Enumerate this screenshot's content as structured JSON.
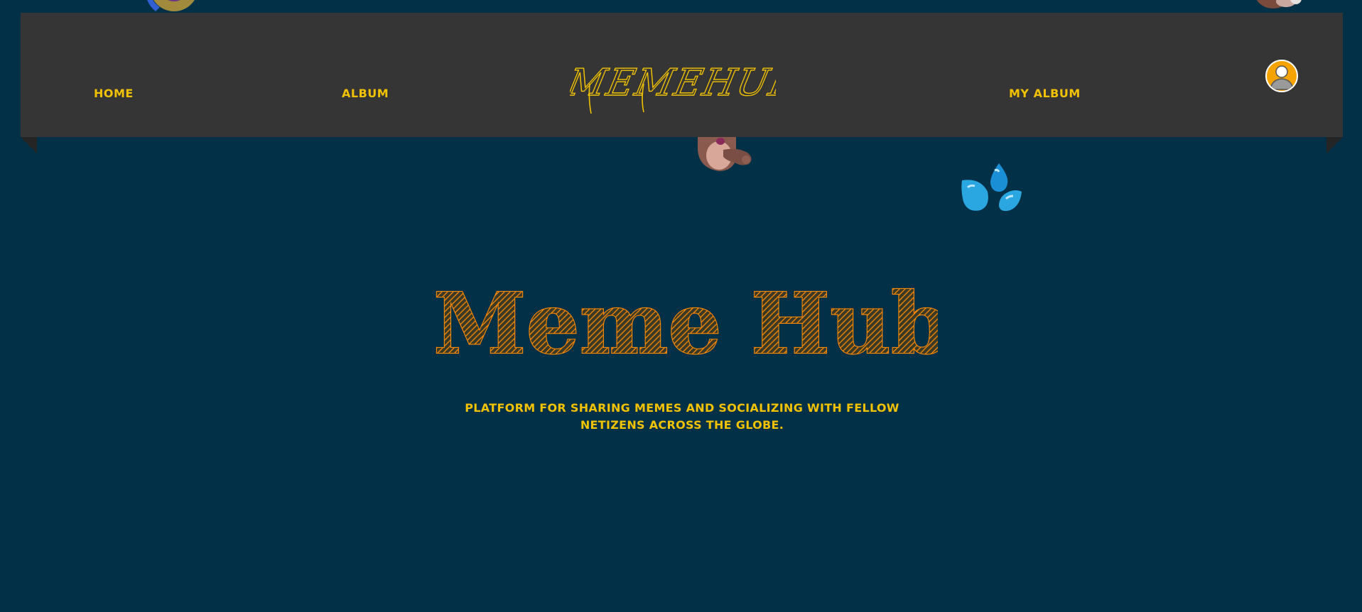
{
  "colors": {
    "background": "#023047",
    "navbar": "#353535",
    "accent_yellow": "#f2c200",
    "title_orange": "#ff8a00",
    "avatar_bg": "#f5a300"
  },
  "nav": {
    "home_label": "HOME",
    "album_label": "ALBUM",
    "logo_text": "MEMEHUB",
    "my_album_label": "MY ALBUM",
    "avatar_icon": "user-avatar-icon"
  },
  "hero": {
    "title": "Meme Hub",
    "subtitle": "PLATFORM FOR SHARING MEMES AND SOCIALIZING WITH FELLOW NETIZENS ACROSS THE GLOBE."
  },
  "decorations": [
    "donut-emoji-icon",
    "bear-emoji-icon",
    "face-emoji-icon",
    "sweat-drops-emoji-icon"
  ]
}
